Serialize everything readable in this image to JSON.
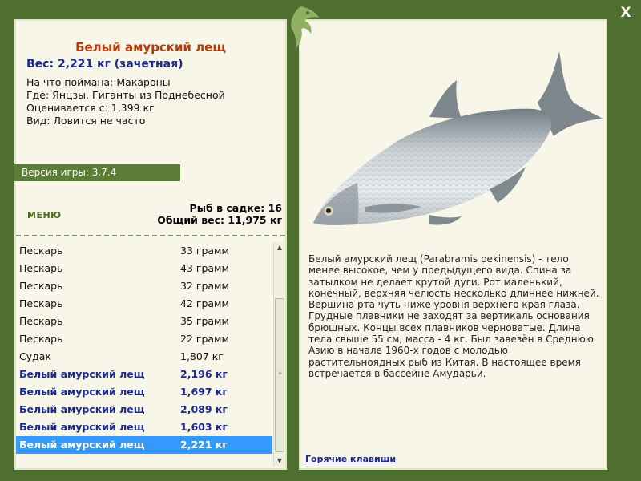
{
  "fish": {
    "title": "Белый амурский лещ",
    "weight": "Вес: 2,221 кг (зачетная)",
    "bait": "На что поймана: Макароны",
    "location": "Где: Янцзы, Гиганты из Поднебесной",
    "valued": "Оценивается с: 1,399 кг",
    "kind": "Вид: Ловится не часто",
    "description": "Белый амурский лещ (Parabramis pekinensis) - тело менее высокое, чем у предыдущего вида. Спина за затылком не делает крутой дуги. Рот маленький, конечный, верхняя челюсть несколько длиннее нижней. Вершина рта чуть ниже уровня верхнего края глаза. Грудные плавники не заходят за вертикаль основания брюшных. Концы всех плавников черноватые. Длина тела свыше 55 см, масса - 4 кг. Был завезён в Среднюю Азию в начале 1960-х годов с молодью растительноядных рыб из Китая. В настоящее время встречается в бассейне Амударьи."
  },
  "version": "Версия игры: 3.7.4",
  "menu_label": "МЕНЮ",
  "stats": {
    "count": "Рыб в садке: 16",
    "total": "Общий вес: 11,975 кг"
  },
  "catch_list": [
    {
      "name": "Пескарь",
      "weight": "33 грамм"
    },
    {
      "name": "Пескарь",
      "weight": "43 грамм"
    },
    {
      "name": "Пескарь",
      "weight": "32 грамм"
    },
    {
      "name": "Пескарь",
      "weight": "42 грамм"
    },
    {
      "name": "Пескарь",
      "weight": "35 грамм"
    },
    {
      "name": "Пескарь",
      "weight": "22 грамм"
    },
    {
      "name": "Судак",
      "weight": "1,807 кг"
    },
    {
      "name": "Белый амурский лещ",
      "weight": "2,196 кг"
    },
    {
      "name": "Белый амурский лещ",
      "weight": "1,697 кг"
    },
    {
      "name": "Белый амурский лещ",
      "weight": "2,089 кг"
    },
    {
      "name": "Белый амурский лещ",
      "weight": "1,603 кг"
    },
    {
      "name": "Белый амурский лещ",
      "weight": "2,221 кг"
    }
  ],
  "close_label": "X",
  "hotkeys_label": "Горячие клавиши",
  "icons": {
    "close": "close-icon",
    "logo": "fish-logo-icon",
    "scroll_up": "scroll-up-icon",
    "scroll_down": "scroll-down-icon"
  },
  "colors": {
    "frame": "#4f6f30",
    "panel": "#f7f6e8",
    "title": "#b33c0a",
    "highlight": "#1c2a8f",
    "selection": "#3399ff"
  }
}
